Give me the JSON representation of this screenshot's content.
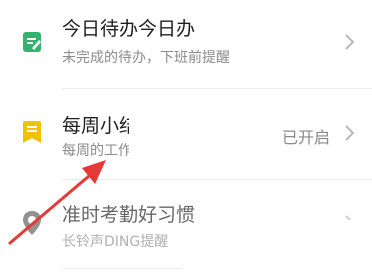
{
  "items": [
    {
      "title": "今日待办今日办",
      "subtitle": "未完成的待办，下班前提醒",
      "icon": "edit-note-icon",
      "icon_color": "#2fb36d"
    },
    {
      "title": "每周小结",
      "subtitle": "每周的工作小结",
      "status": "已开启",
      "icon": "bookmark-note-icon",
      "icon_color": "#f2c200"
    },
    {
      "title": "准时考勤好习惯",
      "subtitle": "长铃声DING提醒",
      "icon": "location-pin-icon",
      "icon_color": "#5f5f5f"
    }
  ],
  "annotation": {
    "arrow_color": "#e53935"
  }
}
